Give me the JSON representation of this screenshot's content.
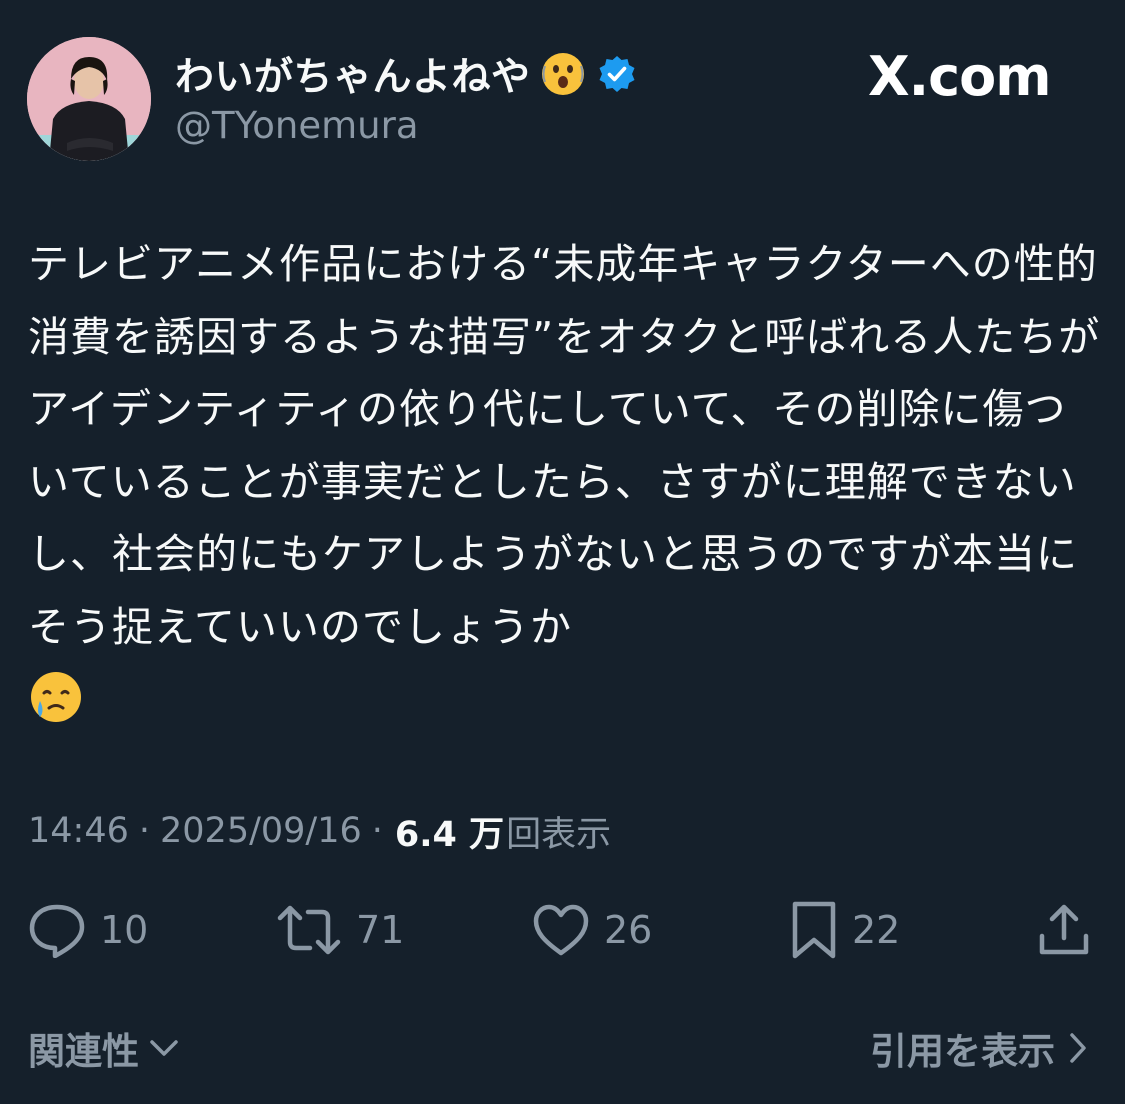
{
  "author": {
    "display_name": "わいがちゃんよねや",
    "handle": "@TYonemura",
    "name_emoji": "face-with-open-mouth-dizzy",
    "verified_badge": "verified-badge-icon"
  },
  "brand": {
    "label": "X.com"
  },
  "tweet": {
    "text": "テレビアニメ作品における“未成年キャラクターへの性的消費を誘因するような描写”をオタクと呼ばれる人たちがアイデンティティの依り代にしていて、その削除に傷ついていることが事実だとしたら、さすがに理解できないし、社会的にもケアしようがないと思うのですが本当にそう捉えていいのでしょうか",
    "trailing_emoji": "face-holding-back-tears"
  },
  "meta": {
    "time": "14:46",
    "separator": "·",
    "date": "2025/09/16",
    "views_count": "6.4 万",
    "views_label": "回表示"
  },
  "actions": {
    "replies": "10",
    "reposts": "71",
    "likes": "26",
    "bookmarks": "22"
  },
  "footer": {
    "related_label": "関連性",
    "quotes_label": "引用を表示"
  },
  "colors": {
    "background": "#15202b",
    "text_primary": "#f7f9f9",
    "text_secondary": "#8b98a5",
    "verified_blue": "#1d9bf0"
  }
}
